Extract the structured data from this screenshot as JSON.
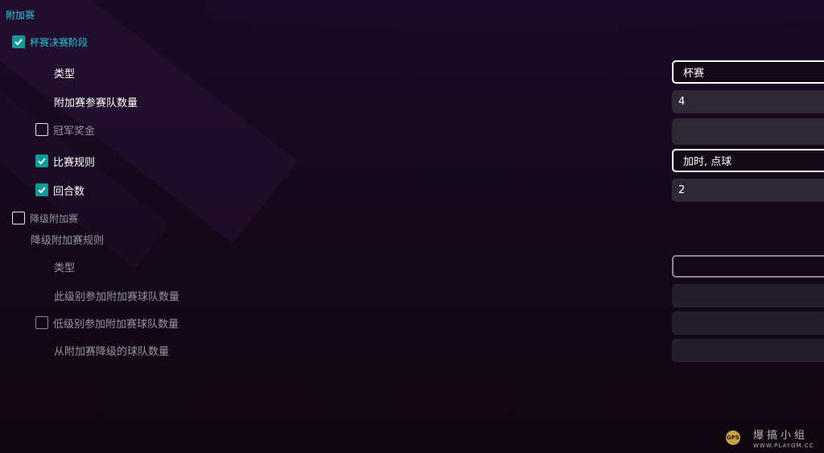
{
  "section_title": "附加赛",
  "cup_stage": {
    "label": "杯赛决赛阶段",
    "checked": true,
    "type_label": "类型",
    "type_value": "杯赛",
    "teams_label": "附加赛参赛队数量",
    "teams_value": "4",
    "prize_label": "冠军奖金",
    "prize_checked": false,
    "prize_value": "",
    "rules_label": "比赛规则",
    "rules_checked": true,
    "rules_value": "加时, 点球",
    "rounds_label": "回合数",
    "rounds_checked": true,
    "rounds_value": "2"
  },
  "relegation": {
    "label": "降级附加赛",
    "checked": false,
    "rules_heading": "降级附加赛规则",
    "type_label": "类型",
    "type_value": "",
    "this_level_label": "此级别参加附加赛球队数量",
    "this_level_value": "",
    "lower_level_label": "低级别参加附加赛球队数量",
    "lower_level_checked": false,
    "lower_level_value": "",
    "relegated_label": "从附加赛降级的球队数量",
    "relegated_value": ""
  },
  "watermark": {
    "logo_text": "GPS",
    "title": "爆搞小组",
    "url": "WWW.PLAYGM.CC"
  },
  "colors": {
    "accent": "#26c6da",
    "checkbox_on": "#0e9a9c",
    "field_bg": "#2d2833",
    "background": "#130818"
  }
}
